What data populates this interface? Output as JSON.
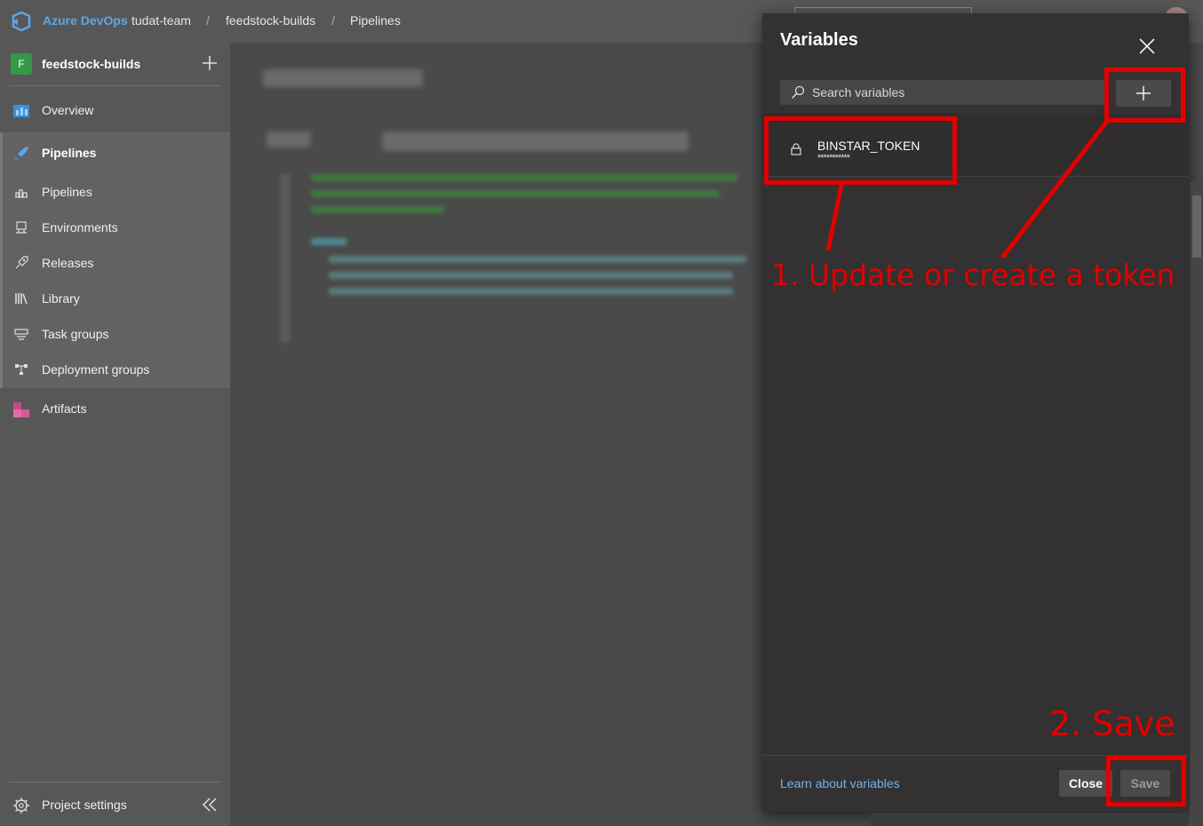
{
  "topbar": {
    "brand": "Azure DevOps",
    "breadcrumbs": [
      "tudat-team",
      "feedstock-builds",
      "Pipelines"
    ],
    "separator": "/"
  },
  "sidebar": {
    "project_initial": "F",
    "project_name": "feedstock-builds",
    "items": [
      {
        "label": "Overview",
        "icon": "overview-icon"
      },
      {
        "label": "Pipelines",
        "icon": "pipelines-icon"
      },
      {
        "label": "Pipelines",
        "icon": "pipeline-sub-icon"
      },
      {
        "label": "Environments",
        "icon": "environments-icon"
      },
      {
        "label": "Releases",
        "icon": "releases-icon"
      },
      {
        "label": "Library",
        "icon": "library-icon"
      },
      {
        "label": "Task groups",
        "icon": "task-groups-icon"
      },
      {
        "label": "Deployment groups",
        "icon": "deployment-groups-icon"
      },
      {
        "label": "Artifacts",
        "icon": "artifacts-icon"
      }
    ],
    "settings_label": "Project settings"
  },
  "panel": {
    "title": "Variables",
    "search_placeholder": "Search variables",
    "variables": [
      {
        "name": "BINSTAR_TOKEN",
        "masked": "***********"
      }
    ],
    "learn_link": "Learn about variables",
    "close_label": "Close",
    "save_label": "Save"
  },
  "annotations": {
    "step1": "1. Update or create a token",
    "step2": "2. Save",
    "color": "#e10000"
  },
  "colors": {
    "brand": "#5aa7e8",
    "link": "#6fb4ee",
    "panel_bg": "#333131",
    "sidebar_bg": "#575757"
  }
}
